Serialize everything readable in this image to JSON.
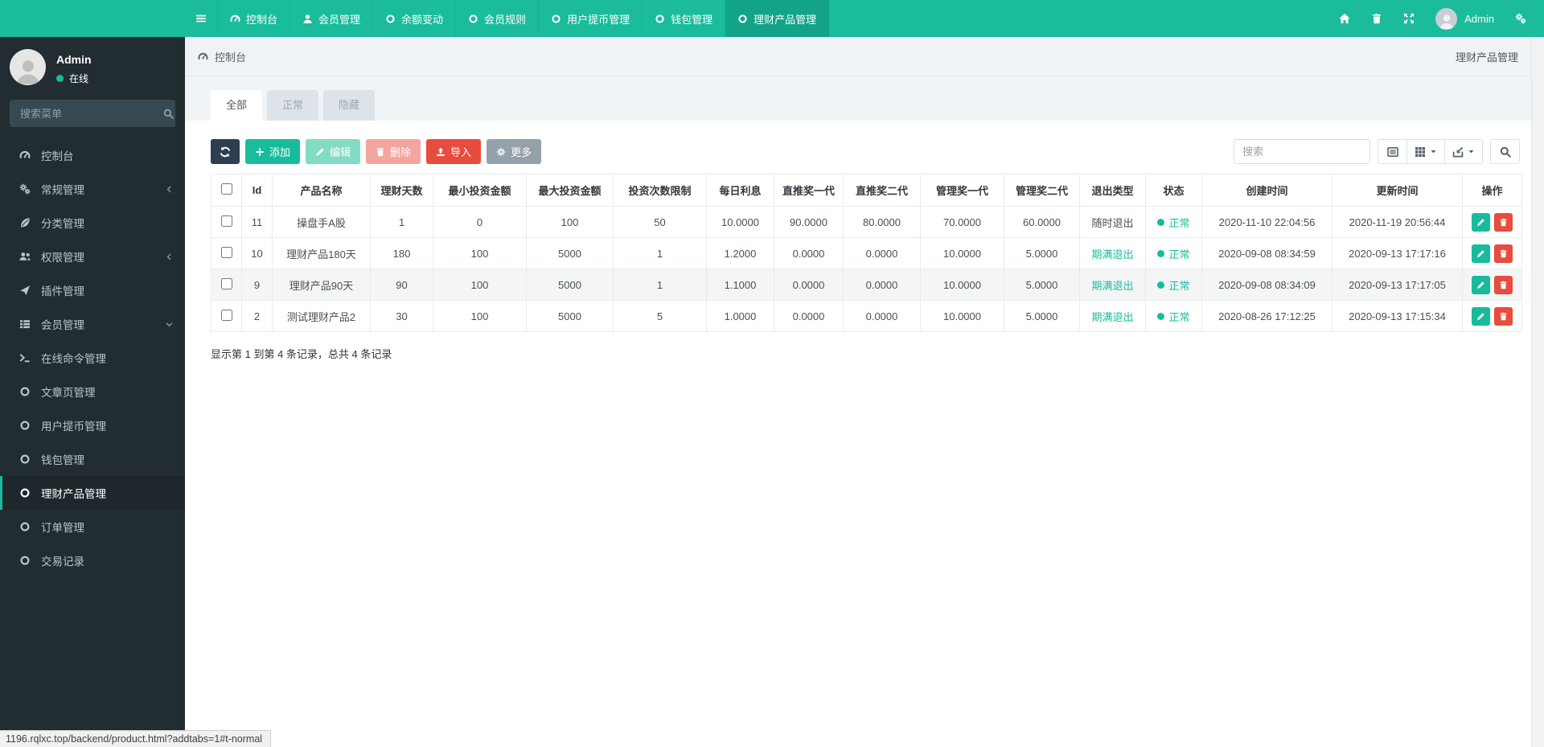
{
  "colors": {
    "primary_teal": "#18BC9C",
    "navbar_teal": "#1ABC9C",
    "navbar_active_tab": "#12A389",
    "sidebar_bg": "#222D32",
    "sidebar_active_bg": "#1E282C",
    "navy_button": "#2C3E50",
    "danger_red": "#E74C3C",
    "gray_button": "#95A1A8",
    "status_green": "#18BC9C"
  },
  "navbar": {
    "items": [
      {
        "label": "控制台",
        "icon": "dashboard",
        "active": false
      },
      {
        "label": "会员管理",
        "icon": "user",
        "active": false
      },
      {
        "label": "余额变动",
        "icon": "circle",
        "active": false
      },
      {
        "label": "会员规则",
        "icon": "circle",
        "active": false
      },
      {
        "label": "用户提币管理",
        "icon": "circle",
        "active": false
      },
      {
        "label": "钱包管理",
        "icon": "circle",
        "active": false
      },
      {
        "label": "理财产品管理",
        "icon": "circle",
        "active": true
      }
    ],
    "user_label": "Admin"
  },
  "sidebar": {
    "user": {
      "name": "Admin",
      "status": "在线"
    },
    "search_placeholder": "搜索菜单",
    "items": [
      {
        "label": "控制台",
        "icon": "dashboard",
        "chevron": null,
        "active": false
      },
      {
        "label": "常规管理",
        "icon": "cogs",
        "chevron": "left",
        "active": false
      },
      {
        "label": "分类管理",
        "icon": "leaf",
        "chevron": null,
        "active": false
      },
      {
        "label": "权限管理",
        "icon": "users",
        "chevron": "left",
        "active": false
      },
      {
        "label": "插件管理",
        "icon": "rocket",
        "chevron": null,
        "active": false
      },
      {
        "label": "会员管理",
        "icon": "list",
        "chevron": "down",
        "active": false
      },
      {
        "label": "在线命令管理",
        "icon": "terminal",
        "chevron": null,
        "active": false
      },
      {
        "label": "文章页管理",
        "icon": "circle",
        "chevron": null,
        "active": false
      },
      {
        "label": "用户提币管理",
        "icon": "circle",
        "chevron": null,
        "active": false
      },
      {
        "label": "钱包管理",
        "icon": "circle",
        "chevron": null,
        "active": false
      },
      {
        "label": "理财产品管理",
        "icon": "circle",
        "chevron": null,
        "active": true
      },
      {
        "label": "订单管理",
        "icon": "circle",
        "chevron": null,
        "active": false
      },
      {
        "label": "交易记录",
        "icon": "circle",
        "chevron": null,
        "active": false
      }
    ]
  },
  "breadcrumb": {
    "location": "控制台",
    "page": "理财产品管理"
  },
  "tabs": [
    {
      "label": "全部",
      "active": true
    },
    {
      "label": "正常",
      "active": false
    },
    {
      "label": "隐藏",
      "active": false
    }
  ],
  "toolbar": {
    "add_label": "添加",
    "edit_label": "编辑",
    "delete_label": "删除",
    "import_label": "导入",
    "more_label": "更多",
    "search_placeholder": "搜索"
  },
  "table": {
    "headers": [
      "Id",
      "产品名称",
      "理财天数",
      "最小投资金额",
      "最大投资金额",
      "投资次数限制",
      "每日利息",
      "直推奖一代",
      "直推奖二代",
      "管理奖一代",
      "管理奖二代",
      "退出类型",
      "状态",
      "创建时间",
      "更新时间",
      "操作"
    ],
    "rows": [
      {
        "id": "11",
        "name": "操盘手A股",
        "days": "1",
        "min": "0",
        "max": "100",
        "limit": "50",
        "interest": "10.0000",
        "zt1": "90.0000",
        "zt2": "80.0000",
        "gl1": "70.0000",
        "gl2": "60.0000",
        "exit": "随时退出",
        "exit_green": false,
        "status": "正常",
        "created": "2020-11-10 22:04:56",
        "updated": "2020-11-19 20:56:44"
      },
      {
        "id": "10",
        "name": "理财产品180天",
        "days": "180",
        "min": "100",
        "max": "5000",
        "limit": "1",
        "interest": "1.2000",
        "zt1": "0.0000",
        "zt2": "0.0000",
        "gl1": "10.0000",
        "gl2": "5.0000",
        "exit": "期满退出",
        "exit_green": true,
        "status": "正常",
        "created": "2020-09-08 08:34:59",
        "updated": "2020-09-13 17:17:16"
      },
      {
        "id": "9",
        "name": "理财产品90天",
        "days": "90",
        "min": "100",
        "max": "5000",
        "limit": "1",
        "interest": "1.1000",
        "zt1": "0.0000",
        "zt2": "0.0000",
        "gl1": "10.0000",
        "gl2": "5.0000",
        "exit": "期满退出",
        "exit_green": true,
        "status": "正常",
        "created": "2020-09-08 08:34:09",
        "updated": "2020-09-13 17:17:05"
      },
      {
        "id": "2",
        "name": "测试理财产品2",
        "days": "30",
        "min": "100",
        "max": "5000",
        "limit": "5",
        "interest": "1.0000",
        "zt1": "0.0000",
        "zt2": "0.0000",
        "gl1": "10.0000",
        "gl2": "5.0000",
        "exit": "期满退出",
        "exit_green": true,
        "status": "正常",
        "created": "2020-08-26 17:12:25",
        "updated": "2020-09-13 17:15:34"
      }
    ],
    "summary": "显示第 1 到第 4 条记录，总共 4 条记录"
  },
  "statusbar": {
    "url": "1196.rqlxc.top/backend/product.html?addtabs=1#t-normal"
  }
}
